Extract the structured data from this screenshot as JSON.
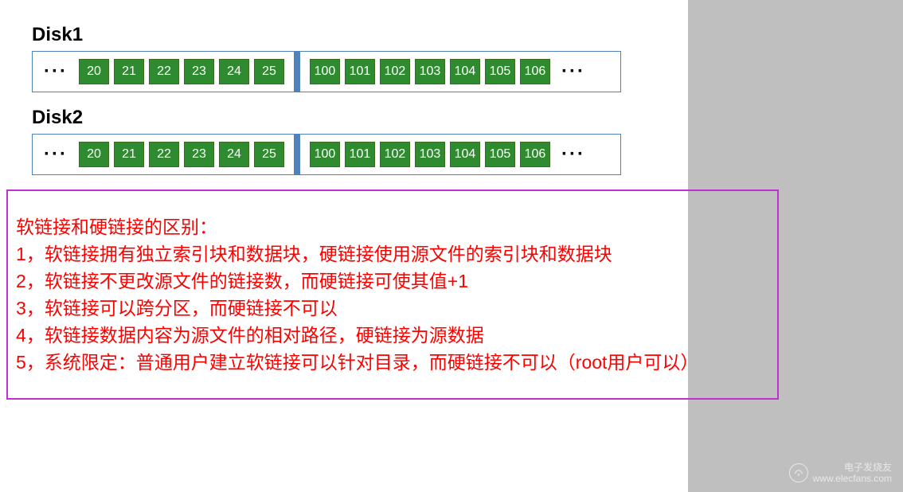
{
  "disk1": {
    "label": "Disk1",
    "left_blocks": [
      "20",
      "21",
      "22",
      "23",
      "24",
      "25"
    ],
    "right_blocks": [
      "100",
      "101",
      "102",
      "103",
      "104",
      "105",
      "106"
    ]
  },
  "disk2": {
    "label": "Disk2",
    "left_blocks": [
      "20",
      "21",
      "22",
      "23",
      "24",
      "25"
    ],
    "right_blocks": [
      "100",
      "101",
      "102",
      "103",
      "104",
      "105",
      "106"
    ]
  },
  "dots": "···",
  "notes": {
    "title": "软链接和硬链接的区别：",
    "lines": [
      "1，软链接拥有独立索引块和数据块，硬链接使用源文件的索引块和数据块",
      "2，软链接不更改源文件的链接数，而硬链接可使其值+1",
      "3，软链接可以跨分区，而硬链接不可以",
      "4，软链接数据内容为源文件的相对路径，硬链接为源数据",
      "5，系统限定：普通用户建立软链接可以针对目录，而硬链接不可以（root用户可以）"
    ]
  },
  "watermark": {
    "name": "电子发烧友",
    "url": "www.elecfans.com"
  }
}
